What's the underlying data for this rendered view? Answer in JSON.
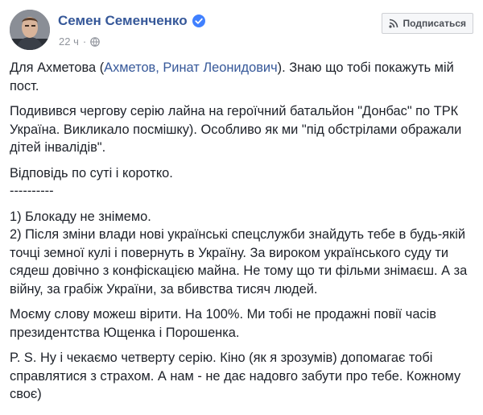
{
  "post": {
    "author": "Семен Семенченко",
    "timestamp": "22 ч",
    "dot": "·",
    "follow_label": "Подписаться",
    "mention": "Ахметов, Ринат Леонидович",
    "p1_before": "Для Ахметова (",
    "p1_after": "). Знаю що тобі покажуть мій пост.",
    "p2": "Подивився чергову серію лайна на героїчний батальйон \"Донбас\" по ТРК Україна. Викликало посмішку). Особливо як ми \"під обстрілами ображали дітей інвалідів\".",
    "p3_line1": "Відповідь по суті і коротко.",
    "p3_line2": "----------",
    "p4_line1": "1) Блокаду не знімемо.",
    "p4_line2": "2) Після зміни влади нові українські спецслужби знайдуть тебе в будь-якій точці земної кулі і повернуть в Україну. За вироком українського суду ти сядеш довічно з конфіскацією майна. Не тому що ти фільми знімаєш. А за війну, за грабіж України, за вбивства тисяч людей.",
    "p5": "Моєму слову можеш вірити. На 100%. Ми тобі не продажні повії часів президентства Ющенка і Порошенка.",
    "p6": "P. S. Ну і чекаємо четверту серію. Кіно (як я зрозумів) допомагає тобі справлятися з страхом. А нам - не дає надовго забути про тебе. Кожному своє)"
  },
  "colors": {
    "link": "#365899",
    "text": "#1d2129",
    "meta": "#90949c",
    "verified": "#4080ff"
  },
  "icons": {
    "verified": "verified-badge-icon",
    "privacy": "globe-icon",
    "follow": "rss-icon"
  }
}
